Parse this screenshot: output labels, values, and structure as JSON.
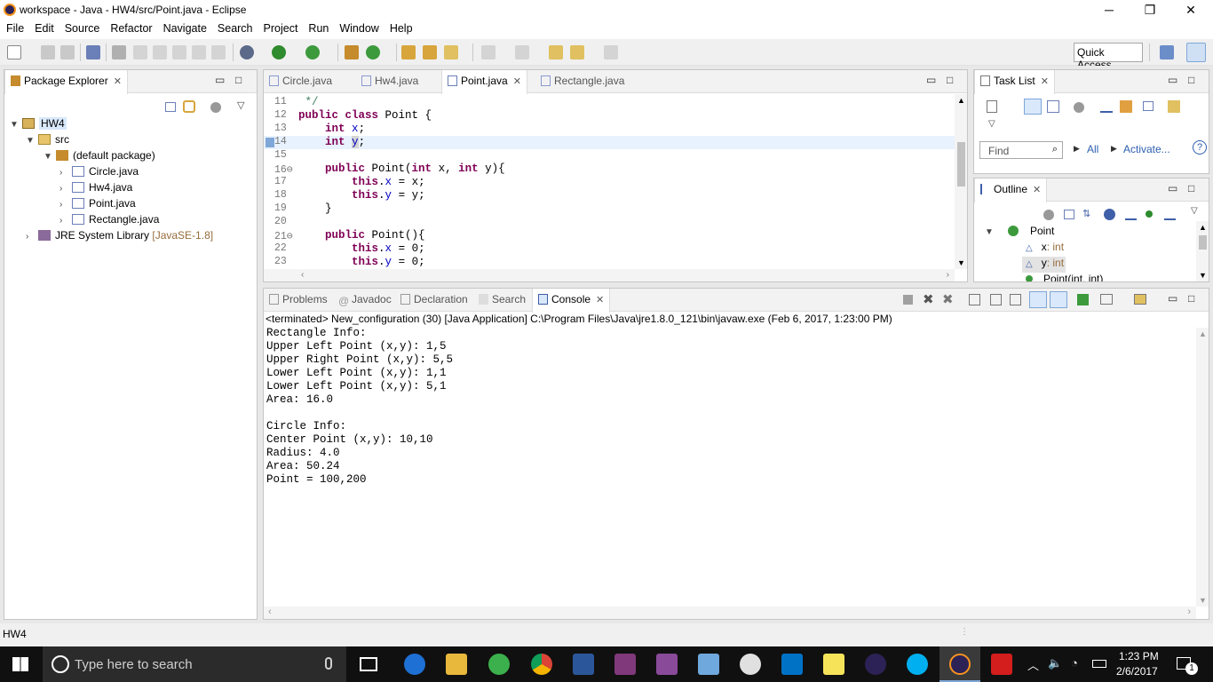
{
  "window": {
    "title": "workspace - Java - HW4/src/Point.java - Eclipse",
    "controls": {
      "minimize": "─",
      "restore": "❐",
      "close": "✕"
    }
  },
  "menu": [
    "File",
    "Edit",
    "Source",
    "Refactor",
    "Navigate",
    "Search",
    "Project",
    "Run",
    "Window",
    "Help"
  ],
  "toolbar": {
    "quick_access": "Quick Access"
  },
  "package_explorer": {
    "tab": "Package Explorer",
    "tree": [
      {
        "label": "HW4",
        "icon": "project-folder-icon"
      },
      {
        "label": "src",
        "icon": "source-folder-icon"
      },
      {
        "label": "(default package)",
        "icon": "package-icon"
      },
      {
        "label": "Circle.java",
        "icon": "java-file-icon"
      },
      {
        "label": "Hw4.java",
        "icon": "java-file-icon"
      },
      {
        "label": "Point.java",
        "icon": "java-file-icon"
      },
      {
        "label": "Rectangle.java",
        "icon": "java-file-icon"
      },
      {
        "label": "JRE System Library",
        "suffix": "[JavaSE-1.8]",
        "icon": "library-icon"
      }
    ]
  },
  "editor": {
    "tabs": [
      "Circle.java",
      "Hw4.java",
      "Point.java",
      "Rectangle.java"
    ],
    "active_tab": "Point.java",
    "lines": [
      {
        "n": "11",
        "text": " */"
      },
      {
        "n": "12",
        "text": "public class Point {"
      },
      {
        "n": "13",
        "text": "    int x;"
      },
      {
        "n": "14",
        "text": "    int y;"
      },
      {
        "n": "15",
        "text": ""
      },
      {
        "n": "16⊖",
        "text": "    public Point(int x, int y){"
      },
      {
        "n": "17",
        "text": "        this.x = x;"
      },
      {
        "n": "18",
        "text": "        this.y = y;"
      },
      {
        "n": "19",
        "text": "    }"
      },
      {
        "n": "20",
        "text": ""
      },
      {
        "n": "21⊖",
        "text": "    public Point(){"
      },
      {
        "n": "22",
        "text": "        this.x = 0;"
      },
      {
        "n": "23",
        "text": "        this.y = 0;"
      }
    ]
  },
  "task_list": {
    "tab": "Task List",
    "find_placeholder": "Find",
    "all": "All",
    "activate": "Activate..."
  },
  "outline": {
    "tab": "Outline",
    "items": [
      {
        "label": "Point",
        "type": ""
      },
      {
        "label": "x",
        "type": ": int"
      },
      {
        "label": "y",
        "type": ": int"
      },
      {
        "label": "Point(int, int)",
        "type": ""
      }
    ]
  },
  "console": {
    "tabs": [
      "Problems",
      "Javadoc",
      "Declaration",
      "Search",
      "Console"
    ],
    "active_tab": "Console",
    "header": "<terminated> New_configuration (30) [Java Application] C:\\Program Files\\Java\\jre1.8.0_121\\bin\\javaw.exe (Feb 6, 2017, 1:23:00 PM)",
    "output": "Rectangle Info:\nUpper Left Point (x,y): 1,5\nUpper Right Point (x,y): 5,5\nLower Left Point (x,y): 1,1\nLower Left Point (x,y): 5,1\nArea: 16.0\n\nCircle Info:\nCenter Point (x,y): 10,10\nRadius: 4.0\nArea: 50.24\nPoint = 100,200"
  },
  "status": {
    "left": "HW4"
  },
  "taskbar": {
    "search_placeholder": "Type here to search",
    "time": "1:23 PM",
    "date": "2/6/2017",
    "notifications": "1"
  }
}
